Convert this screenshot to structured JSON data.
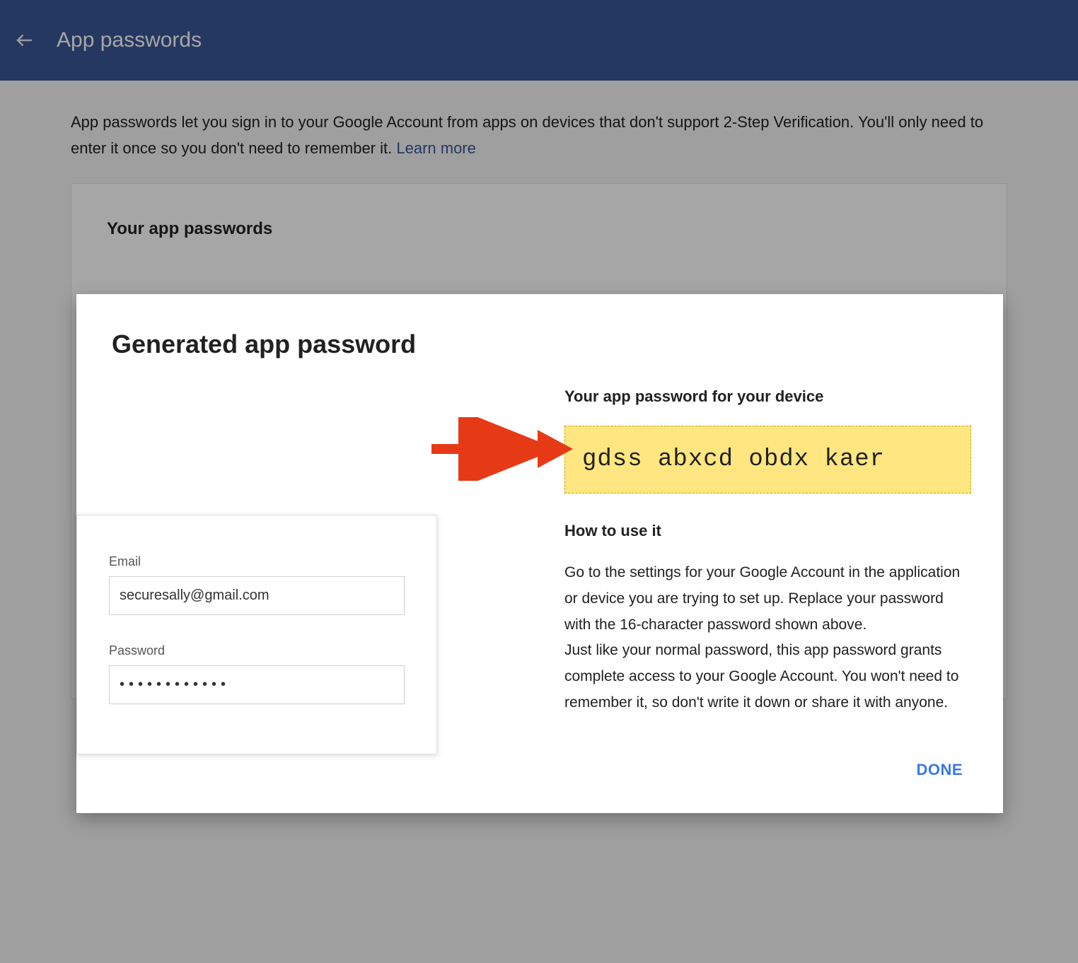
{
  "header": {
    "title": "App passwords"
  },
  "intro": {
    "text_before_link": "App passwords let you sign in to your Google Account from apps on devices that don't support 2-Step Verification. You'll only need to enter it once so you don't need to remember it. ",
    "link_text": "Learn more"
  },
  "section": {
    "heading": "Your app passwords"
  },
  "modal": {
    "title": "Generated app password",
    "login": {
      "email_label": "Email",
      "email_value": "securesally@gmail.com",
      "password_label": "Password",
      "password_value": "••••••••••••"
    },
    "right": {
      "subhead": "Your app password for your device",
      "generated_password": "gdss abxcd obdx kaer",
      "howto_heading": "How to use it",
      "body1": "Go to the settings for your Google Account in the application or device you are trying to set up. Replace your password with the 16-character password shown above.",
      "body2": "Just like your normal password, this app password grants complete access to your Google Account. You won't need to remember it, so don't write it down or share it with anyone."
    },
    "done_label": "DONE"
  },
  "colors": {
    "header_bg": "#3a5795",
    "password_bg": "#ffe680",
    "link": "#3b78e7",
    "arrow": "#e63a17"
  }
}
